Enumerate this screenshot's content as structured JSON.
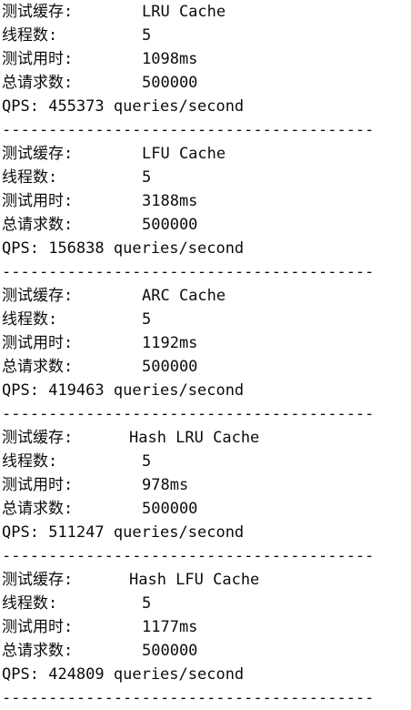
{
  "labels": {
    "cache": "测试缓存:",
    "threads": "线程数:",
    "time": "测试用时:",
    "requests": "总请求数:",
    "qps_prefix": "QPS:",
    "qps_suffix": "queries/second"
  },
  "separator": "----------------------------------------",
  "results": [
    {
      "cache": "LRU Cache",
      "threads": "5",
      "time": "1098ms",
      "requests": "500000",
      "qps": "455373"
    },
    {
      "cache": "LFU Cache",
      "threads": "5",
      "time": "3188ms",
      "requests": "500000",
      "qps": "156838"
    },
    {
      "cache": "ARC Cache",
      "threads": "5",
      "time": "1192ms",
      "requests": "500000",
      "qps": "419463"
    },
    {
      "cache": "Hash LRU Cache",
      "threads": "5",
      "time": "978ms",
      "requests": "500000",
      "qps": "511247"
    },
    {
      "cache": "Hash LFU Cache",
      "threads": "5",
      "time": "1177ms",
      "requests": "500000",
      "qps": "424809"
    }
  ]
}
